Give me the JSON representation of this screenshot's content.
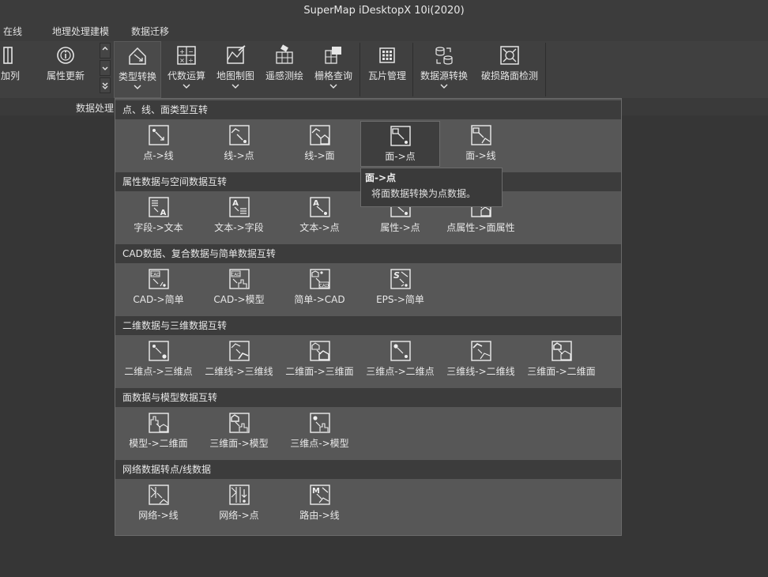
{
  "window": {
    "title": "SuperMap iDesktopX 10i(2020)"
  },
  "menubar": {
    "items": [
      "在线",
      "地理处理建模",
      "数据迁移"
    ]
  },
  "ribbon": {
    "buttons": [
      {
        "label": "加列",
        "icon": "add-column-icon"
      },
      {
        "label": "属性更新",
        "icon": "info-icon"
      },
      {
        "label": "类型转换",
        "icon": "type-convert-icon"
      },
      {
        "label": "代数运算",
        "icon": "algebra-icon"
      },
      {
        "label": "地图制图",
        "icon": "map-drawing-icon"
      },
      {
        "label": "遥感测绘",
        "icon": "satellite-icon"
      },
      {
        "label": "栅格查询",
        "icon": "raster-query-icon"
      },
      {
        "label": "瓦片管理",
        "icon": "tile-icon"
      },
      {
        "label": "数据源转换",
        "icon": "datasource-convert-icon"
      },
      {
        "label": "破损路面检测",
        "icon": "road-detect-icon"
      }
    ],
    "group_label": "数据处理"
  },
  "dropdown": {
    "sections": [
      {
        "title": "点、线、面类型互转",
        "items": [
          "点->线",
          "线->点",
          "线->面",
          "面->点",
          "面->线"
        ]
      },
      {
        "title": "属性数据与空间数据互转",
        "items": [
          "字段->文本",
          "文本->字段",
          "文本->点",
          "属性->点",
          "点属性->面属性"
        ]
      },
      {
        "title": "CAD数据、复合数据与简单数据互转",
        "items": [
          "CAD->简单",
          "CAD->模型",
          "简单->CAD",
          "EPS->简单"
        ]
      },
      {
        "title": "二维数据与三维数据互转",
        "items": [
          "二维点->三维点",
          "二维线->三维线",
          "二维面->三维面",
          "三维点->二维点",
          "三维线->二维线",
          "三维面->二维面"
        ]
      },
      {
        "title": "面数据与模型数据互转",
        "items": [
          "模型->二维面",
          "三维面->模型",
          "三维点->模型"
        ]
      },
      {
        "title": "网络数据转点/线数据",
        "items": [
          "网络->线",
          "网络->点",
          "路由->线"
        ]
      }
    ]
  },
  "tooltip": {
    "title": "面->点",
    "body": "将面数据转换为点数据。"
  }
}
